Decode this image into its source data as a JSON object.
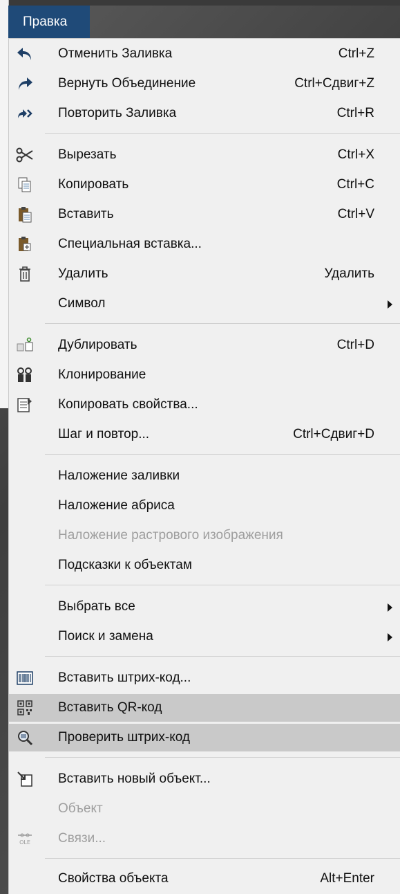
{
  "menu_title": "Правка",
  "items": [
    {
      "label": "Отменить Заливка",
      "shortcut": "Ctrl+Z",
      "icon": "undo-icon"
    },
    {
      "label": "Вернуть Объединение",
      "shortcut": "Ctrl+Сдвиг+Z",
      "icon": "redo-icon"
    },
    {
      "label": "Повторить Заливка",
      "shortcut": "Ctrl+R",
      "icon": "repeat-icon"
    },
    {
      "label": "Вырезать",
      "shortcut": "Ctrl+X",
      "icon": "cut-icon"
    },
    {
      "label": "Копировать",
      "shortcut": "Ctrl+C",
      "icon": "copy-icon"
    },
    {
      "label": "Вставить",
      "shortcut": "Ctrl+V",
      "icon": "paste-icon"
    },
    {
      "label": "Специальная вставка...",
      "shortcut": "",
      "icon": "paste-special-icon"
    },
    {
      "label": "Удалить",
      "shortcut": "Удалить",
      "icon": "trash-icon"
    },
    {
      "label": "Символ",
      "shortcut": "",
      "icon": "",
      "submenu": true
    },
    {
      "label": "Дублировать",
      "shortcut": "Ctrl+D",
      "icon": "duplicate-icon"
    },
    {
      "label": "Клонирование",
      "shortcut": "",
      "icon": "clone-icon"
    },
    {
      "label": "Копировать свойства...",
      "shortcut": "",
      "icon": "copy-properties-icon"
    },
    {
      "label": "Шаг и повтор...",
      "shortcut": "Ctrl+Сдвиг+D",
      "icon": ""
    },
    {
      "label": "Наложение заливки",
      "shortcut": "",
      "icon": ""
    },
    {
      "label": "Наложение абриса",
      "shortcut": "",
      "icon": ""
    },
    {
      "label": "Наложение растрового изображения",
      "shortcut": "",
      "icon": "",
      "disabled": true
    },
    {
      "label": "Подсказки к объектам",
      "shortcut": "",
      "icon": ""
    },
    {
      "label": "Выбрать все",
      "shortcut": "",
      "icon": "",
      "submenu": true
    },
    {
      "label": "Поиск и замена",
      "shortcut": "",
      "icon": "",
      "submenu": true
    },
    {
      "label": "Вставить штрих-код...",
      "shortcut": "",
      "icon": "barcode-icon"
    },
    {
      "label": "Вставить QR-код",
      "shortcut": "",
      "icon": "qr-code-icon",
      "highlight": true
    },
    {
      "label": "Проверить штрих-код",
      "shortcut": "",
      "icon": "magnifier-barcode-icon",
      "highlight": true
    },
    {
      "label": "Вставить новый объект...",
      "shortcut": "",
      "icon": "insert-object-icon"
    },
    {
      "label": "Объект",
      "shortcut": "",
      "icon": "",
      "disabled": true
    },
    {
      "label": "Связи...",
      "shortcut": "",
      "icon": "ole-links-icon",
      "disabled": true,
      "icon_text": "OLE"
    },
    {
      "label": "Свойства объекта",
      "shortcut": "Alt+Enter",
      "icon": ""
    }
  ],
  "colors": {
    "menubar": "#1f4a78",
    "highlight": "#c9c9c9",
    "disabled_text": "#9e9e9e"
  }
}
